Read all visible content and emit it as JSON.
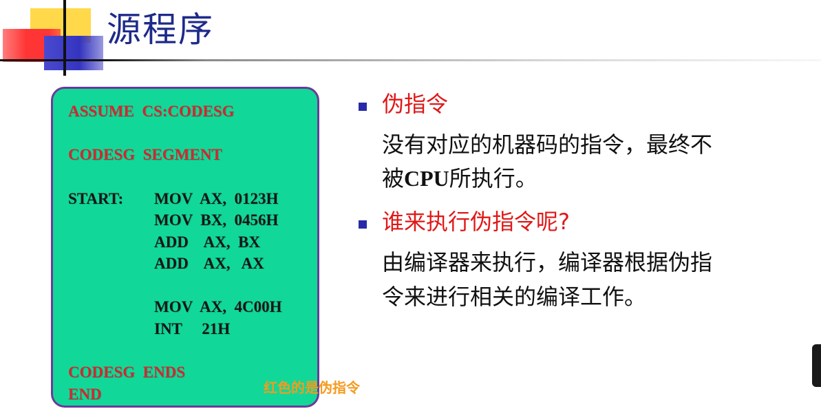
{
  "slide": {
    "title": "源程序"
  },
  "code": {
    "lines": [
      {
        "text": "ASSUME  CS:CODESG",
        "pseudo": true
      },
      {
        "text": "CODESG  SEGMENT",
        "pseudo": true
      },
      {
        "text": "START:",
        "pseudo": false
      },
      {
        "text": "MOV  AX,  0123H",
        "pseudo": false
      },
      {
        "text": "MOV  BX,  0456H",
        "pseudo": false
      },
      {
        "text": "ADD    AX,  BX",
        "pseudo": false
      },
      {
        "text": "ADD    AX,   AX",
        "pseudo": false
      },
      {
        "text": "MOV  AX,  4C00H",
        "pseudo": false
      },
      {
        "text": "INT     21H",
        "pseudo": false
      },
      {
        "text": "CODESG  ENDS",
        "pseudo": true
      },
      {
        "text": "END",
        "pseudo": true
      }
    ]
  },
  "overlay_note": "红色的是伪指令",
  "right": {
    "bullet1": {
      "heading": "伪指令",
      "line1": "没有对应的机器码的指令，最终不",
      "line2_prefix": "被",
      "line2_cpu": "CPU",
      "line2_suffix": "所执行。"
    },
    "bullet2": {
      "heading": "谁来执行伪指令呢?",
      "line1": "由编译器来执行，编译器根据伪指",
      "line2": "令来进行相关的编译工作。"
    }
  },
  "colors": {
    "title": "#1e2a8a",
    "code_bg": "#11d898",
    "code_border": "#6b3a9a",
    "pseudo_text": "#d4262f",
    "heading_red": "#e01818",
    "bullet_square": "#2a2aa8",
    "overlay_orange": "#f59a1e"
  }
}
